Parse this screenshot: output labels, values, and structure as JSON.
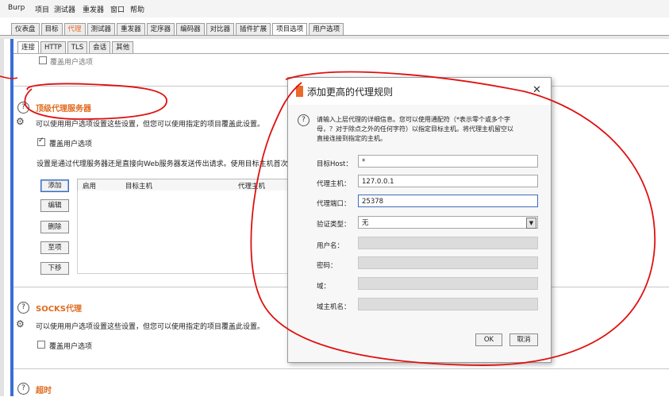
{
  "menu": [
    "Burp",
    "项目",
    "测试器",
    "重发器",
    "窗口",
    "帮助"
  ],
  "main_tabs": [
    "仪表盘",
    "目标",
    "代理",
    "测试器",
    "重发器",
    "定序器",
    "编码器",
    "对比器",
    "插件扩展",
    "项目选项",
    "用户选项"
  ],
  "sub_tabs": [
    "连接",
    "HTTP",
    "TLS",
    "会话",
    "其他"
  ],
  "top_section": {
    "override_label": "覆盖用户选项"
  },
  "upstream": {
    "title": "顶级代理服务器",
    "desc": "可以使用用户选项设置这些设置，但您可以使用指定的项目覆盖此设置。",
    "override_label": "覆盖用户选项",
    "explain": "设置是通过代理服务器还是直接向Web服务器发送传出请求。使用目标主机首次",
    "buttons": [
      "添加",
      "编辑",
      "删除",
      "至项",
      "下移"
    ],
    "columns": [
      "启用",
      "目标主机",
      "代理主机"
    ]
  },
  "socks": {
    "title": "SOCKS代理",
    "desc": "可以使用用户选项设置这些设置，但您可以使用指定的项目覆盖此设置。",
    "override_label": "覆盖用户选项"
  },
  "timeout": {
    "title": "超时"
  },
  "dialog": {
    "title": "添加更高的代理规则",
    "close": "✕",
    "help_text_1": "请输入上层代理的详细信息。您可以使用通配符（*表示零个或多个字",
    "help_text_2": "母，？对于除点之外的任何字符）以指定目标主机。将代理主机留空以",
    "help_text_3": "直接连接到指定的主机。",
    "fields": {
      "dest_host_label": "目标Host：",
      "dest_host_value": "*",
      "proxy_host_label": "代理主机：",
      "proxy_host_value": "127.0.0.1",
      "proxy_port_label": "代理端口：",
      "proxy_port_value": "25378",
      "auth_type_label": "验证类型：",
      "auth_type_value": "无",
      "username_label": "用户名：",
      "password_label": "密码：",
      "domain_label": "域：",
      "domain_host_label": "域主机名："
    },
    "ok": "OK",
    "cancel": "取消"
  },
  "colors": {
    "accent_orange": "#ea6a2a",
    "annotation_red": "#e01010",
    "blue_bar": "#3a6ed6"
  }
}
